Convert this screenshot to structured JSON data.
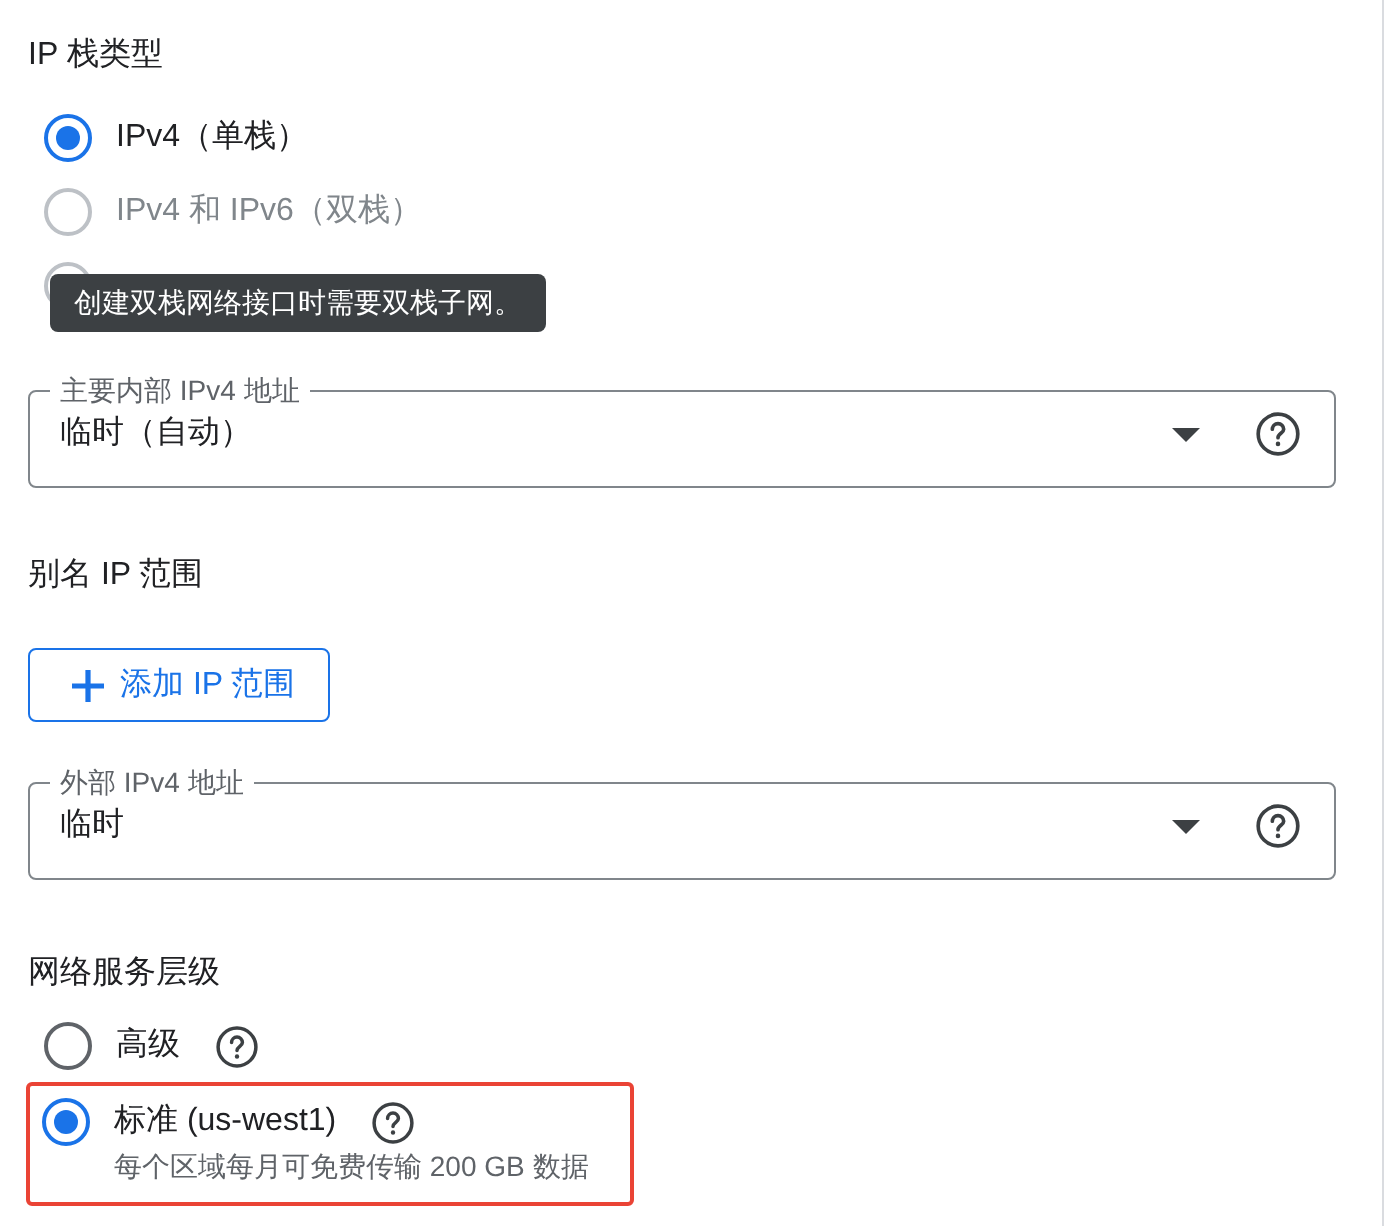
{
  "ip_stack_type": {
    "title": "IP 栈类型",
    "options": [
      {
        "label": "IPv4（单栈）",
        "selected": true,
        "disabled": false
      },
      {
        "label": "IPv4 和 IPv6（双栈）",
        "selected": false,
        "disabled": true
      },
      {
        "disabled": true
      }
    ],
    "tooltip": "创建双栈网络接口时需要双栈子网。"
  },
  "primary_internal_ipv4": {
    "label": "主要内部 IPv4 地址",
    "value": "临时（自动）"
  },
  "alias_ip_ranges": {
    "title": "别名 IP 范围",
    "add_button": "添加 IP 范围"
  },
  "external_ipv4": {
    "label": "外部 IPv4 地址",
    "value": "临时"
  },
  "network_service_tier": {
    "title": "网络服务层级",
    "options": [
      {
        "label": "高级",
        "selected": false,
        "highlighted": false
      },
      {
        "label": "标准 (us-west1)",
        "description": "每个区域每月可免费传输 200 GB 数据",
        "selected": true,
        "highlighted": true
      }
    ]
  }
}
